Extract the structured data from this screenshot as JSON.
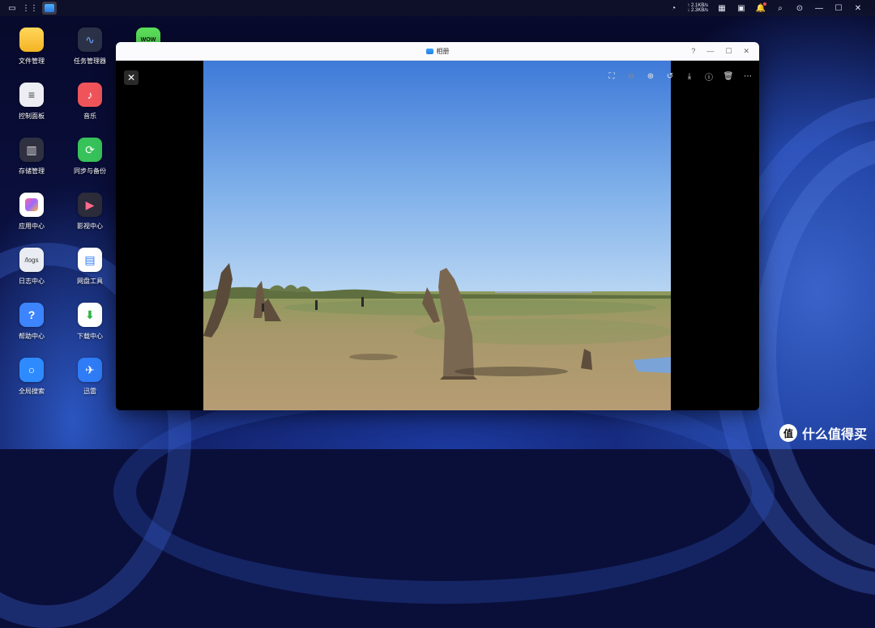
{
  "topbar": {
    "left_icons": [
      "window-icon",
      "grid-icon",
      "photos-app-icon"
    ],
    "net_up": "↑ 2.1KB/s",
    "net_down": "↓ 2.3KB/s",
    "right_icons": [
      "network-icon",
      "dashboard-icon",
      "monitor-icon",
      "notification-icon",
      "search-icon",
      "user-icon",
      "minimize-icon",
      "maximize-icon",
      "close-icon"
    ]
  },
  "desktop": {
    "icons": [
      {
        "label": "文件管理",
        "color": "#f6c335",
        "glyph": "▭"
      },
      {
        "label": "任务管理器",
        "color": "#2b3147",
        "glyph": "∿"
      },
      {
        "label": "控制面板",
        "color": "#eceef3",
        "glyph": "≡"
      },
      {
        "label": "音乐",
        "color": "#f0545b",
        "glyph": "♪"
      },
      {
        "label": "存储管理",
        "color": "#2f3040",
        "glyph": "▥"
      },
      {
        "label": "同步与备份",
        "color": "#37c25a",
        "glyph": "⟳"
      },
      {
        "label": "应用中心",
        "color": "#ffffff",
        "glyph": "✚"
      },
      {
        "label": "影视中心",
        "color": "#2c2c3a",
        "glyph": "▶"
      },
      {
        "label": "日志中心",
        "color": "#e9ecf2",
        "glyph": "/logs"
      },
      {
        "label": "网盘工具",
        "color": "#ffffff",
        "glyph": "☁"
      },
      {
        "label": "帮助中心",
        "color": "#3d84ff",
        "glyph": "?"
      },
      {
        "label": "下载中心",
        "color": "#ffffff",
        "glyph": "⬇"
      },
      {
        "label": "全局搜索",
        "color": "#2e8bff",
        "glyph": "○"
      },
      {
        "label": "迅雷",
        "color": "#2f7cf6",
        "glyph": "✈"
      }
    ],
    "partial_icon_label": "WOW"
  },
  "window": {
    "title": "相册",
    "help": "?",
    "minimize": "—",
    "maximize": "☐",
    "close": "✕",
    "viewer": {
      "close": "✕",
      "tools": [
        {
          "name": "fit-screen-icon",
          "glyph": "⛶"
        },
        {
          "name": "zoom-out-icon",
          "glyph": "⊖"
        },
        {
          "name": "zoom-in-icon",
          "glyph": "⊕"
        },
        {
          "name": "rotate-icon",
          "glyph": "↺"
        },
        {
          "name": "download-icon",
          "glyph": "⤓"
        },
        {
          "name": "info-icon",
          "glyph": "ⓘ"
        },
        {
          "name": "delete-icon",
          "glyph": "🗑"
        },
        {
          "name": "more-icon",
          "glyph": "⋯"
        }
      ]
    }
  },
  "watermark": {
    "badge": "值",
    "text": "什么值得买"
  }
}
